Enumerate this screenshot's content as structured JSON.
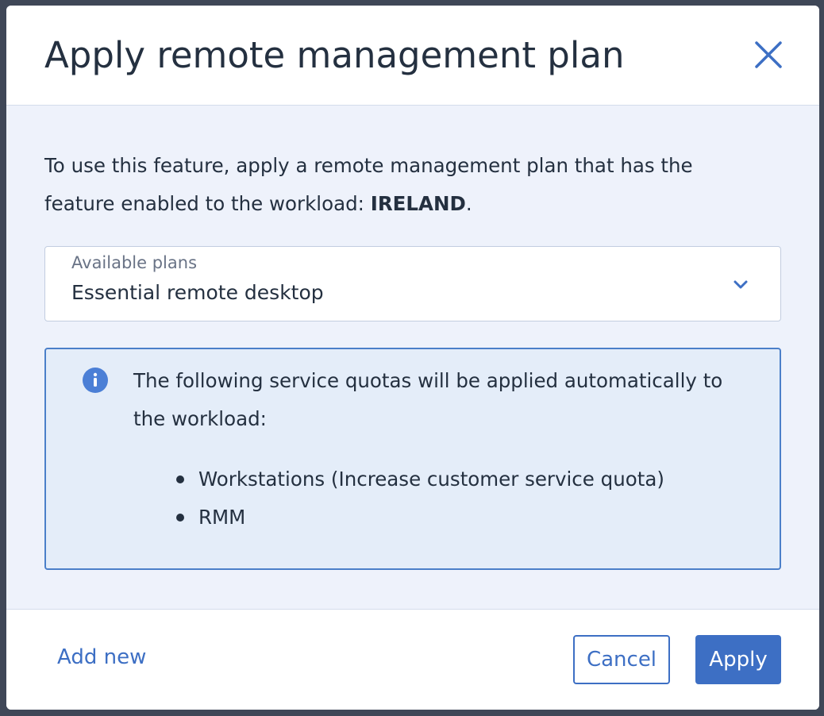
{
  "dialog": {
    "title": "Apply remote management plan",
    "close_icon": "close-icon"
  },
  "intro": {
    "text_before": "To use this feature, apply a remote management plan that has the feature enabled to the workload: ",
    "workload": "IRELAND",
    "text_after": "."
  },
  "plan_select": {
    "label": "Available plans",
    "value": "Essential remote desktop",
    "icon": "chevron-down-icon"
  },
  "info": {
    "icon": "info-icon",
    "text": "The following service quotas will be applied automatically to the workload:",
    "items": [
      "Workstations (Increase customer service quota)",
      "RMM"
    ]
  },
  "footer": {
    "add_new_label": "Add new",
    "cancel_label": "Cancel",
    "apply_label": "Apply"
  },
  "colors": {
    "accent": "#3d6fc4",
    "text": "#243040",
    "info_bg": "#e4edf9",
    "body_bg": "#eef2fb"
  }
}
